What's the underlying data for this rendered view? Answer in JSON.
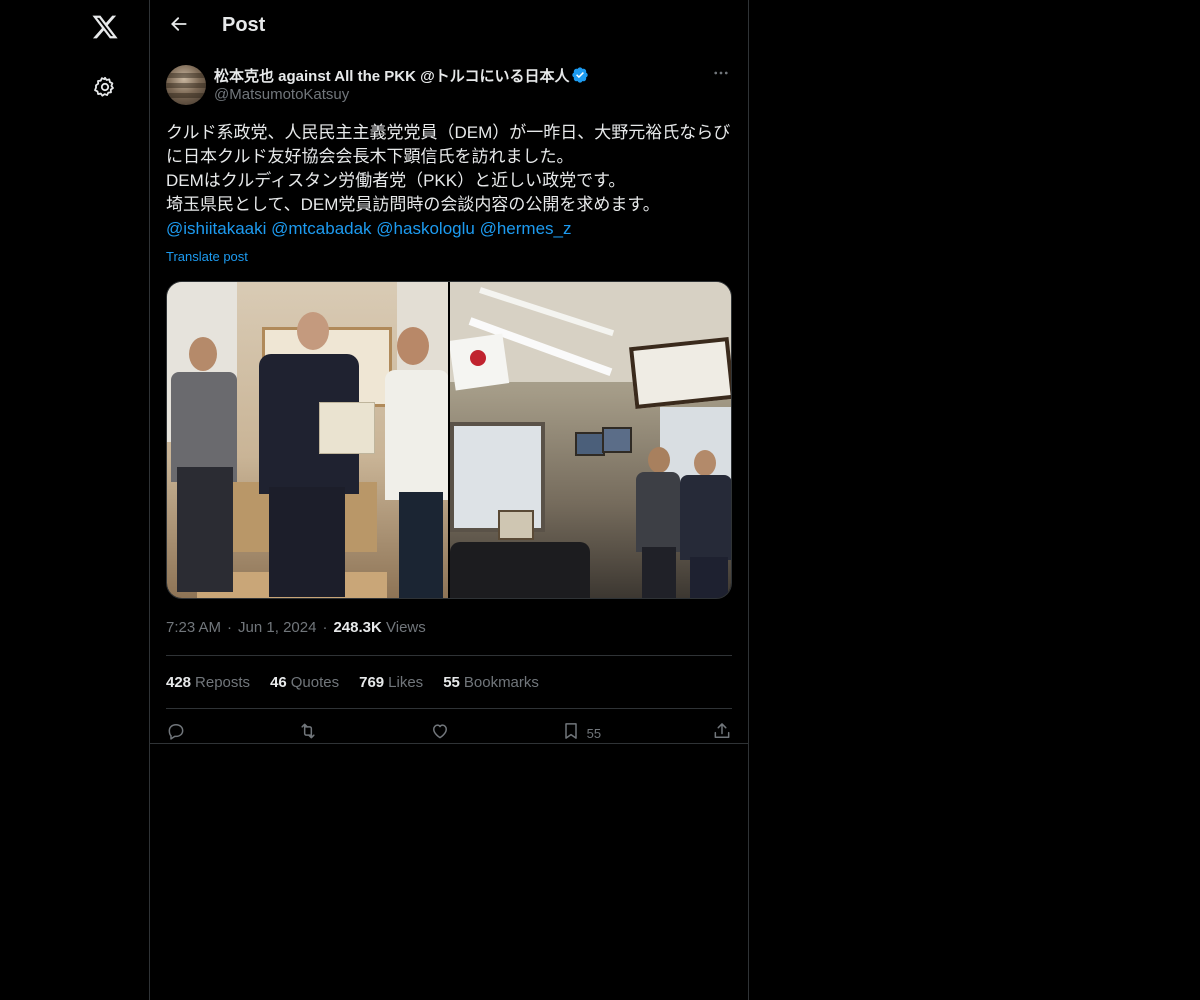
{
  "header": {
    "title": "Post"
  },
  "author": {
    "name": "松本克也 against All the PKK @トルコにいる日本人",
    "handle": "@MatsumotoKatsuy",
    "verified": true
  },
  "post": {
    "lines": [
      "クルド系政党、人民民主主義党党員（DEM）が一昨日、大野元裕氏ならびに日本クルド友好協会会長木下顕信氏を訪れました。",
      "DEMはクルディスタン労働者党（PKK）と近しい政党です。",
      "埼玉県民として、DEM党員訪問時の会談内容の公開を求めます。"
    ],
    "mentions": [
      "@ishiitakaaki",
      "@mtcabadak",
      "@haskologlu",
      "@hermes_z"
    ],
    "translate_label": "Translate post"
  },
  "meta": {
    "time": "7:23 AM",
    "date": "Jun 1, 2024",
    "views_count": "248.3K",
    "views_label": "Views"
  },
  "stats": [
    {
      "num": "428",
      "label": "Reposts"
    },
    {
      "num": "46",
      "label": "Quotes"
    },
    {
      "num": "769",
      "label": "Likes"
    },
    {
      "num": "55",
      "label": "Bookmarks"
    }
  ],
  "actions": {
    "bookmark_count": "55"
  },
  "icons": {
    "logo": "x-logo-icon",
    "settings": "gear-icon",
    "back": "arrow-left-icon",
    "more": "more-horizontal-icon",
    "reply": "reply-icon",
    "repost": "repost-icon",
    "like": "heart-icon",
    "bookmark": "bookmark-icon",
    "share": "share-icon",
    "verified": "verified-badge-icon"
  },
  "colors": {
    "accent": "#1d9bf0",
    "background": "#000000",
    "text": "#e7e9ea",
    "muted": "#71767b",
    "border": "#2f3336"
  }
}
